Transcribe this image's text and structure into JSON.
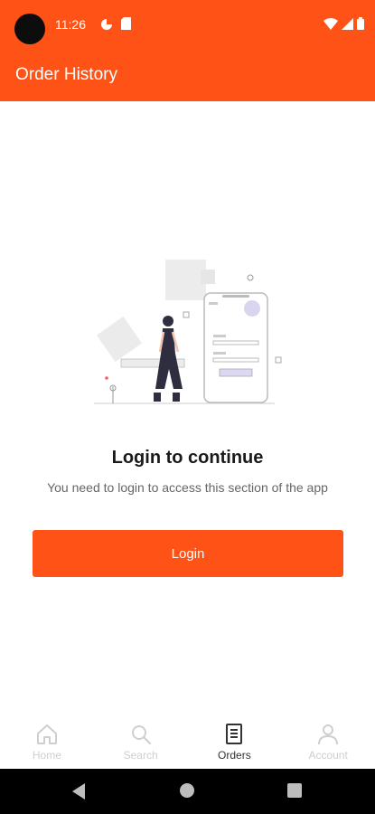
{
  "status_bar": {
    "time": "11:26"
  },
  "app_bar": {
    "title": "Order History"
  },
  "main": {
    "heading": "Login to continue",
    "message": "You need to login to access this section of the app",
    "login_button": "Login",
    "illustration": "person-with-phone-login-illustration"
  },
  "bottom_nav": {
    "items": [
      {
        "label": "Home",
        "icon": "home-icon",
        "active": false
      },
      {
        "label": "Search",
        "icon": "search-icon",
        "active": false
      },
      {
        "label": "Orders",
        "icon": "orders-icon",
        "active": true
      },
      {
        "label": "Account",
        "icon": "account-icon",
        "active": false
      }
    ]
  },
  "colors": {
    "accent": "#ff5216",
    "inactive": "#cfcfcf",
    "active": "#333333"
  }
}
